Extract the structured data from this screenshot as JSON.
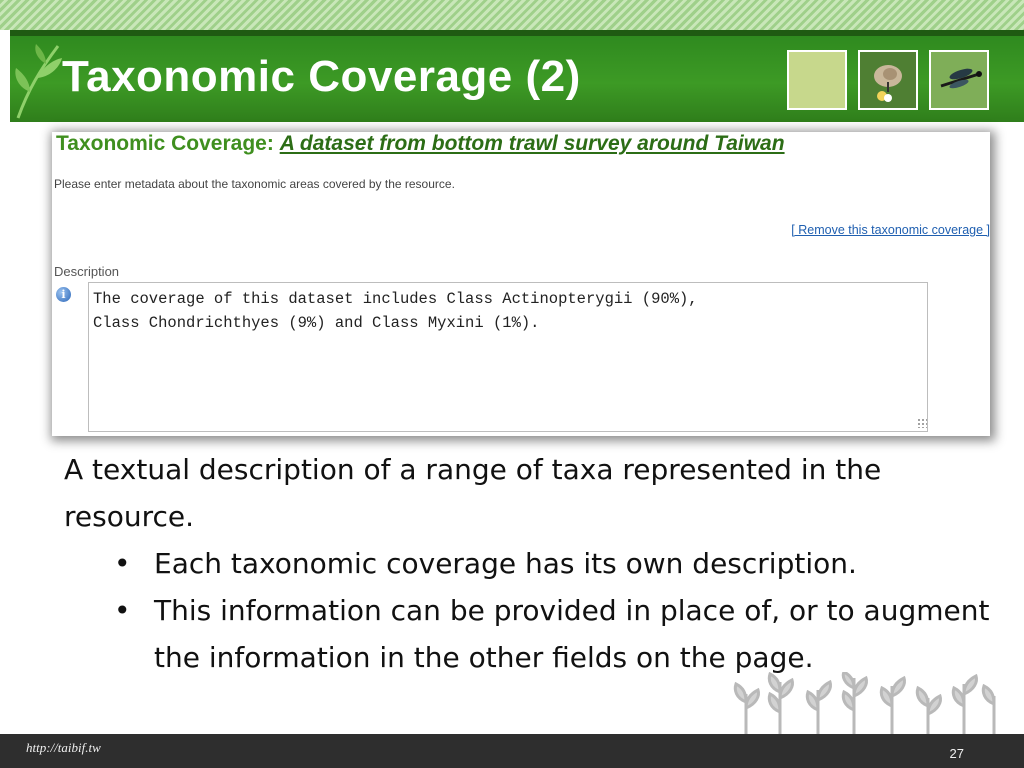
{
  "slide": {
    "title": "Taxonomic Coverage (2)"
  },
  "panel": {
    "title_prefix": "Taxonomic Coverage:",
    "title_link": "A dataset from bottom trawl survey around Taiwan",
    "help_text": "Please enter metadata about the taxonomic areas covered by the resource.",
    "remove_link": "[ Remove this taxonomic coverage ]",
    "description_label": "Description",
    "info_glyph": "i",
    "description_value": "The coverage of this dataset includes Class Actinopterygii (90%),\nClass Chondrichthyes (9%) and Class Myxini (1%)."
  },
  "body": {
    "intro": "A textual description of a range of taxa represented in the resource.",
    "bullet_char": "•",
    "bullets": [
      "Each taxonomic coverage has its own description.",
      "This information can be provided in place of, or to augment the information in the other fields on the page."
    ]
  },
  "footer": {
    "url": "http://taibif.tw",
    "page_number": "27"
  },
  "icons": {
    "header_decor": "leaf-icon",
    "info": "info-icon",
    "footer_decor": "sprout-icon"
  },
  "colors": {
    "header_green": "#3d9a25",
    "title_green": "#3f8f1f",
    "link_blue": "#1f5fb0",
    "footer_dark": "#2e2e2e"
  }
}
